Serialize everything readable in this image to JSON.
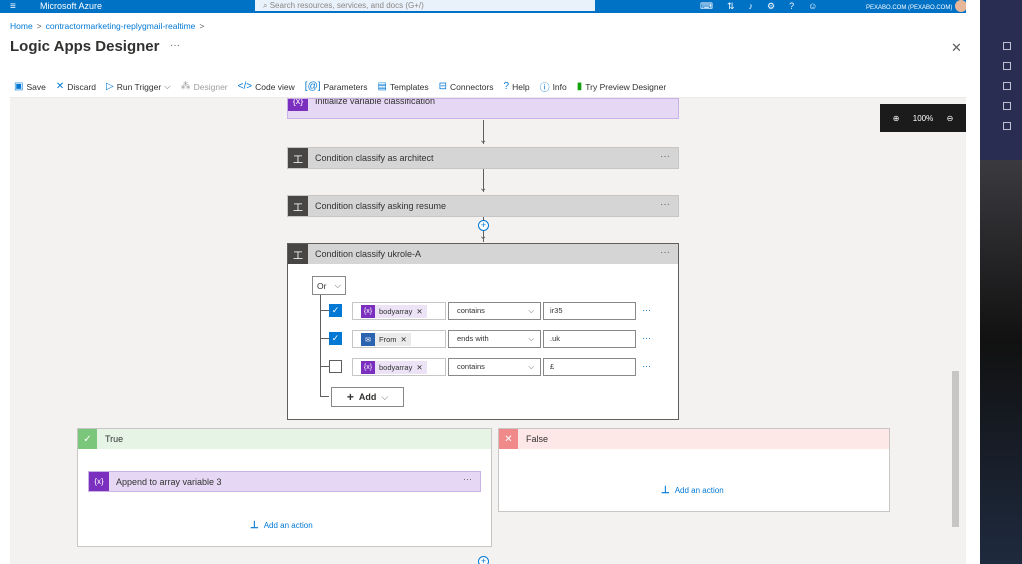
{
  "topbar": {
    "menu_icon": "hamburger-icon",
    "brand": "Microsoft Azure",
    "search_placeholder": "Search resources, services, and docs (G+/)",
    "account": "PEXABO.COM (PEXABO.COM)"
  },
  "breadcrumb": {
    "home": "Home",
    "resource": "contractormarketing-replygmail-realtime"
  },
  "page": {
    "title": "Logic Apps Designer",
    "title_more": "···"
  },
  "toolbar": {
    "save": "Save",
    "discard": "Discard",
    "run_trigger": "Run Trigger",
    "designer": "Designer",
    "code_view": "Code view",
    "parameters": "Parameters",
    "templates": "Templates",
    "connectors": "Connectors",
    "help": "Help",
    "info": "Info",
    "try_preview": "Try Preview Designer"
  },
  "zoom": {
    "level": "100%"
  },
  "steps": {
    "init_var": "Initialize variable classification",
    "cond_architect": "Condition classify as architect",
    "cond_resume": "Condition classify asking resume",
    "cond_ukrole": "Condition classify ukrole-A",
    "more": "···"
  },
  "condition": {
    "group_operator": "Or",
    "rows": [
      {
        "checked": true,
        "token": "bodyarray",
        "token_icon": "variable-icon",
        "operator": "contains",
        "value": "ir35"
      },
      {
        "checked": true,
        "token": "From",
        "token_icon": "mail-icon",
        "operator": "ends with",
        "value": ".uk"
      },
      {
        "checked": false,
        "token": "bodyarray",
        "token_icon": "variable-icon",
        "operator": "contains",
        "value": "£"
      }
    ],
    "row_more": "···",
    "add_label": "Add"
  },
  "branches": {
    "true_label": "True",
    "false_label": "False",
    "true_action": "Append to array variable 3",
    "add_action": "Add an action"
  },
  "colors": {
    "azure_blue": "#0072c6",
    "accent": "#0078d4",
    "true_green": "#7ac67a",
    "false_red": "#f08a8a",
    "variable_purple": "#7b2fbe"
  }
}
